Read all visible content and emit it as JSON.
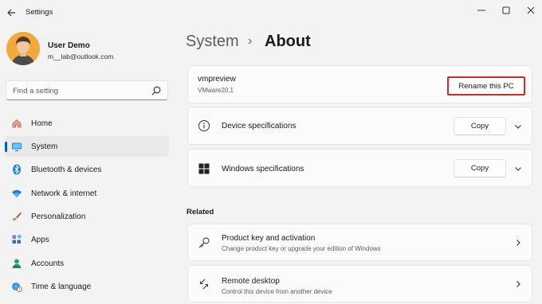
{
  "window": {
    "title": "Settings",
    "back_icon": "back-arrow-icon",
    "minimize_icon": "minimize-icon",
    "maximize_icon": "maximize-icon",
    "close_icon": "close-icon"
  },
  "profile": {
    "name": "User Demo",
    "email": "m__lab@outlook.com"
  },
  "search": {
    "placeholder": "Find a setting",
    "icon": "search-icon"
  },
  "sidebar": {
    "items": [
      {
        "label": "Home",
        "icon": "home-icon",
        "active": false
      },
      {
        "label": "System",
        "icon": "monitor-icon",
        "active": true
      },
      {
        "label": "Bluetooth & devices",
        "icon": "bluetooth-icon",
        "active": false
      },
      {
        "label": "Network & internet",
        "icon": "wifi-icon",
        "active": false
      },
      {
        "label": "Personalization",
        "icon": "paintbrush-icon",
        "active": false
      },
      {
        "label": "Apps",
        "icon": "apps-icon",
        "active": false
      },
      {
        "label": "Accounts",
        "icon": "account-icon",
        "active": false
      },
      {
        "label": "Time & language",
        "icon": "globe-clock-icon",
        "active": false
      }
    ]
  },
  "breadcrumb": {
    "parent": "System",
    "separator": "›",
    "current": "About"
  },
  "device": {
    "name": "vmpreview",
    "model": "VMware20,1",
    "rename_label": "Rename this PC"
  },
  "specs": {
    "device_title": "Device specifications",
    "device_copy": "Copy",
    "windows_title": "Windows specifications",
    "windows_copy": "Copy"
  },
  "related": {
    "heading": "Related",
    "items": [
      {
        "title": "Product key and activation",
        "subtitle": "Change product key or upgrade your edition of Windows",
        "icon": "key-icon"
      },
      {
        "title": "Remote desktop",
        "subtitle": "Control this device from another device",
        "icon": "remote-desktop-icon"
      }
    ]
  },
  "colors": {
    "accent": "#005fb8",
    "highlight_border": "#d12b2b",
    "background": "#f3f3f3",
    "card": "#fbfbfb"
  }
}
